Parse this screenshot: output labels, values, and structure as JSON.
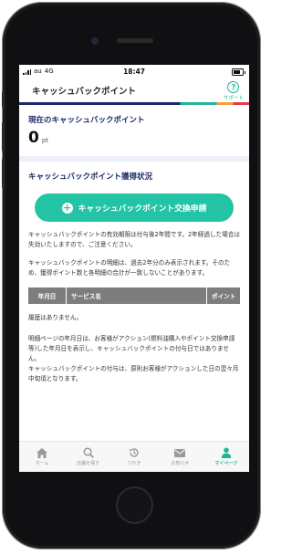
{
  "status_bar": {
    "carrier": "au",
    "network": "4G",
    "time": "18:47"
  },
  "header": {
    "title": "キャッシュバックポイント",
    "support_label": "サポート"
  },
  "current_points": {
    "label": "現在のキャッシュバックポイント",
    "value": "0",
    "unit": "pt"
  },
  "acquisition": {
    "heading": "キャッシュバックポイント獲得状況",
    "apply_button_label": "キャッシュバックポイント交換申請",
    "paragraphs": [
      "キャッシュバックポイントの有効期限は付与後2年間です。2年経過した場合は失効いたしますので、ご注意ください。",
      "キャッシュバックポイントの明細は、過去2年分のみ表示されます。そのため、獲得ポイント数と各明細の合計が一致しないことがあります。"
    ],
    "table_headers": [
      "年月日",
      "サービス名",
      "ポイント"
    ],
    "empty_message": "履歴はありません。",
    "notes": [
      "明細ページの年月日は、お客様がアクション(燃料油購入やポイント交換申請等)した年月日を表示し、キャッシュバックポイントの付与日ではありません。",
      "キャッシュバックポイントの付与は、原則お客様がアクションした日の翌々月中旬頃となります。"
    ]
  },
  "tabbar": {
    "items": [
      {
        "label": "ホーム",
        "icon": "home-icon",
        "active": false
      },
      {
        "label": "店舗を探す",
        "icon": "search-icon",
        "active": false
      },
      {
        "label": "りれき",
        "icon": "history-icon",
        "active": false
      },
      {
        "label": "お知らせ",
        "icon": "mail-icon",
        "active": false
      },
      {
        "label": "マイページ",
        "icon": "person-icon",
        "active": true
      }
    ]
  },
  "colors": {
    "accent": "#23c3a6",
    "navy": "#1b2a66",
    "inactive": "#999999"
  }
}
